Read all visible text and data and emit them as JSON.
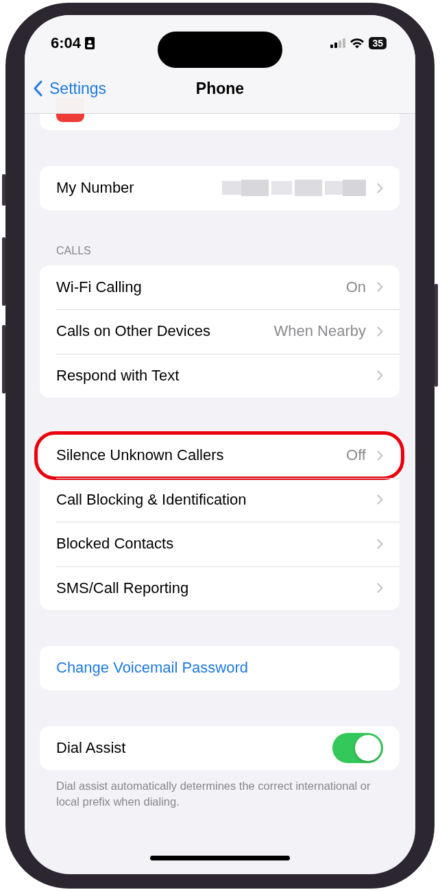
{
  "status_bar": {
    "time": "6:04",
    "battery": "35"
  },
  "nav": {
    "back": "Settings",
    "title": "Phone"
  },
  "groups": [
    {
      "rows": [
        {
          "kind": "blurred",
          "label": "My Number",
          "highlighted": false
        }
      ]
    },
    {
      "header": "CALLS",
      "rows": [
        {
          "kind": "link",
          "label": "Wi-Fi Calling",
          "value": "On",
          "highlighted": false
        },
        {
          "kind": "link",
          "label": "Calls on Other Devices",
          "value": "When Nearby",
          "highlighted": false
        },
        {
          "kind": "link",
          "label": "Respond with Text",
          "highlighted": false
        }
      ]
    },
    {
      "rows": [
        {
          "kind": "link",
          "label": "Silence Unknown Callers",
          "value": "Off",
          "highlighted": true
        },
        {
          "kind": "link",
          "label": "Call Blocking & Identification",
          "highlighted": false
        },
        {
          "kind": "link",
          "label": "Blocked Contacts",
          "highlighted": false
        },
        {
          "kind": "link",
          "label": "SMS/Call Reporting",
          "highlighted": false
        }
      ]
    },
    {
      "rows": [
        {
          "kind": "action",
          "label": "Change Voicemail Password",
          "highlighted": false
        }
      ]
    },
    {
      "rows": [
        {
          "kind": "toggle",
          "label": "Dial Assist",
          "on": true,
          "highlighted": false
        }
      ],
      "footer": "Dial assist automatically determines the correct international or local prefix when dialing."
    }
  ]
}
